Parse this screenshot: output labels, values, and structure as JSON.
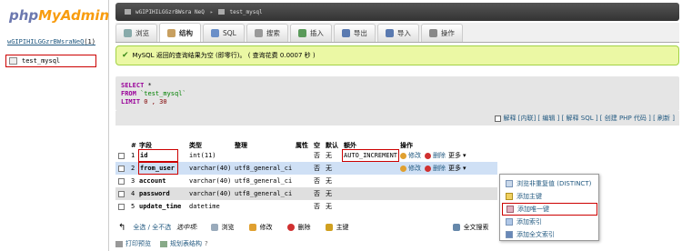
{
  "left": {
    "logo_php": "php",
    "logo_my": "MyAdmin",
    "db_name": "wGIPIHILGGzrBWsraNeQ",
    "db_count": "(1)",
    "table": "test_mysql"
  },
  "breadcrumb": {
    "server": "wGIPIHILGGzrBWsra NeQ",
    "table": "test_mysql"
  },
  "tabs": [
    {
      "label": "浏览"
    },
    {
      "label": "结构"
    },
    {
      "label": "SQL"
    },
    {
      "label": "搜索"
    },
    {
      "label": "插入"
    },
    {
      "label": "导出"
    },
    {
      "label": "导入"
    },
    {
      "label": "操作"
    }
  ],
  "success_msg": "MySQL 返回的查询结果为空 (即零行)。 ( 查询花费 0.0007 秒 )",
  "sql": {
    "select": "SELECT",
    "star": "*",
    "from": "FROM",
    "table": "`test_mysql`",
    "limit": "LIMIT",
    "limit_vals": "0 , 30"
  },
  "sql_links": "解释 [内联] [ 编辑 ] [ 解释 SQL ] [ 创建 PHP 代码 ] [ 刷新 ]",
  "headers": {
    "num": "#",
    "field": "字段",
    "type": "类型",
    "collation": "整理",
    "attr": "属性",
    "null": "空",
    "default": "默认",
    "extra": "额外",
    "action": "操作"
  },
  "rows": [
    {
      "num": "1",
      "field": "id",
      "type": "int(11)",
      "collation": "",
      "null": "否",
      "default": "无",
      "extra": "AUTO_INCREMENT"
    },
    {
      "num": "2",
      "field": "from_user",
      "type": "varchar(40)",
      "collation": "utf8_general_ci",
      "null": "否",
      "default": "无",
      "extra": ""
    },
    {
      "num": "3",
      "field": "account",
      "type": "varchar(40)",
      "collation": "utf8_general_ci",
      "null": "否",
      "default": "无",
      "extra": ""
    },
    {
      "num": "4",
      "field": "password",
      "type": "varchar(40)",
      "collation": "utf8_general_ci",
      "null": "否",
      "default": "无",
      "extra": ""
    },
    {
      "num": "5",
      "field": "update_time",
      "type": "datetime",
      "collation": "",
      "null": "否",
      "default": "无",
      "extra": ""
    }
  ],
  "row_actions": {
    "edit": "修改",
    "delete": "删除",
    "more": "更多"
  },
  "dropdown": [
    "浏览非重复值 (DISTINCT)",
    "添加主键",
    "添加唯一键",
    "添加索引",
    "添加全文索引"
  ],
  "bottom": {
    "check_all": "全选 / 全不选",
    "selected": "选中项:",
    "browse": "浏览",
    "edit": "修改",
    "delete": "删除",
    "primary": "主键",
    "fulltext": "全文搜索"
  },
  "footer": {
    "print": "打印预览",
    "propose": "规划表结构"
  },
  "colors": {
    "link": "#235a81",
    "success_bg": "#ebf8a4",
    "highlight_red": "#cc0000"
  }
}
